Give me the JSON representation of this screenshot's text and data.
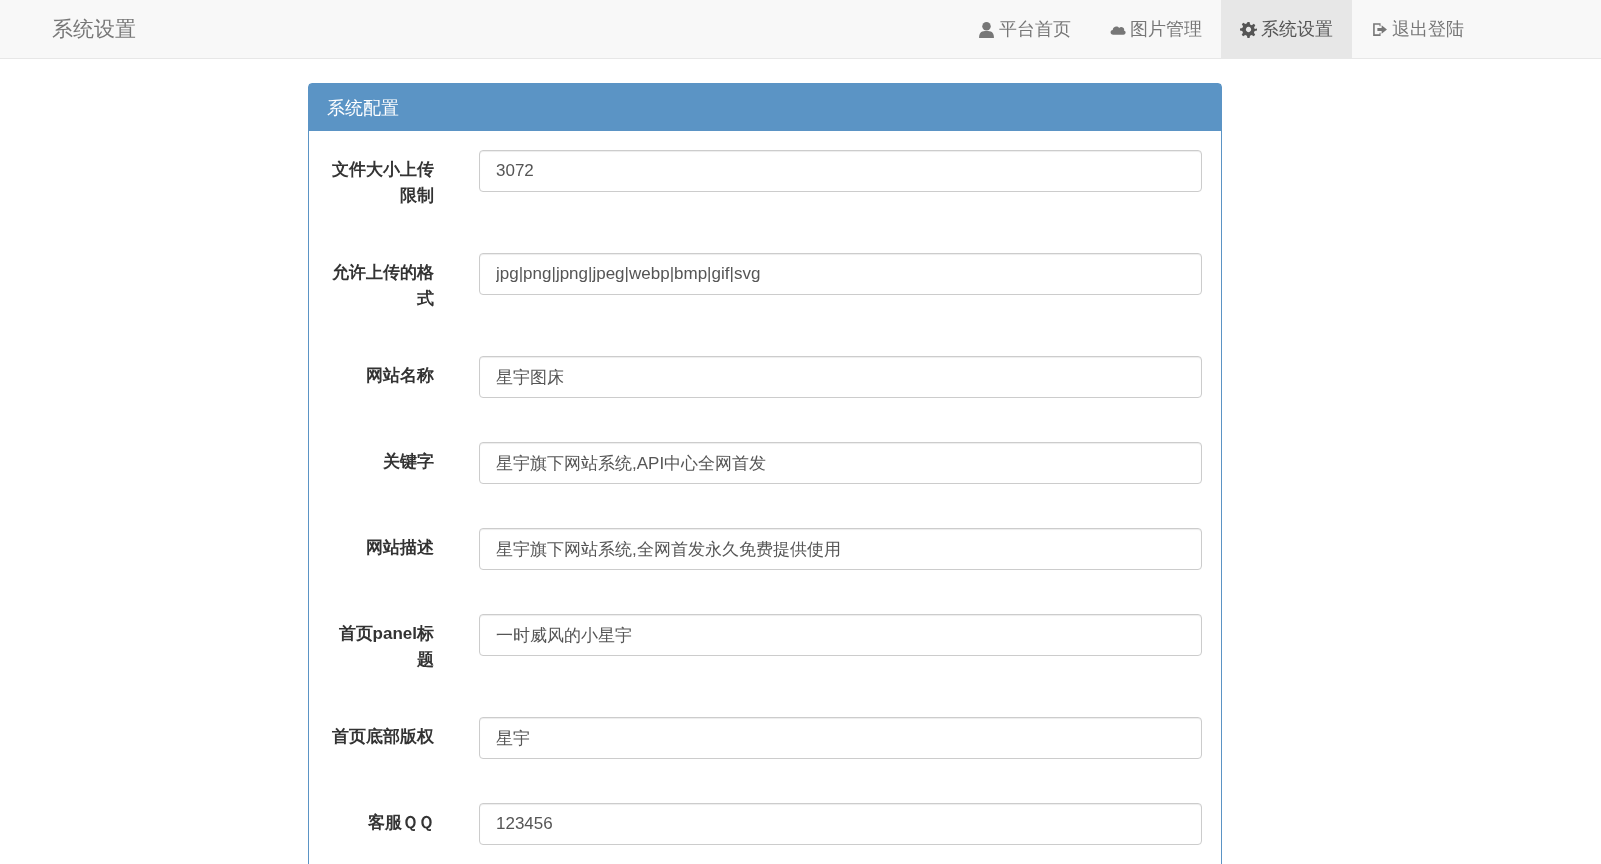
{
  "navbar": {
    "brand": "系统设置",
    "items": [
      {
        "label": "平台首页",
        "selected": false
      },
      {
        "label": "图片管理",
        "selected": false
      },
      {
        "label": "系统设置",
        "selected": true
      },
      {
        "label": "退出登陆",
        "selected": false
      }
    ]
  },
  "panel": {
    "title": "系统配置",
    "fields": [
      {
        "label": "文件大小上传限制",
        "value": "3072"
      },
      {
        "label": "允许上传的格式",
        "value": "jpg|png|jpng|jpeg|webp|bmp|gif|svg"
      },
      {
        "label": "网站名称",
        "value": "星宇图床"
      },
      {
        "label": "关键字",
        "value": "星宇旗下网站系统,API中心全网首发"
      },
      {
        "label": "网站描述",
        "value": "星宇旗下网站系统,全网首发永久免费提供使用"
      },
      {
        "label": "首页panel标题",
        "value": "一时威风的小星宇"
      },
      {
        "label": "首页底部版权",
        "value": "星宇"
      },
      {
        "label": "客服ＱＱ",
        "value": "123456"
      }
    ]
  }
}
